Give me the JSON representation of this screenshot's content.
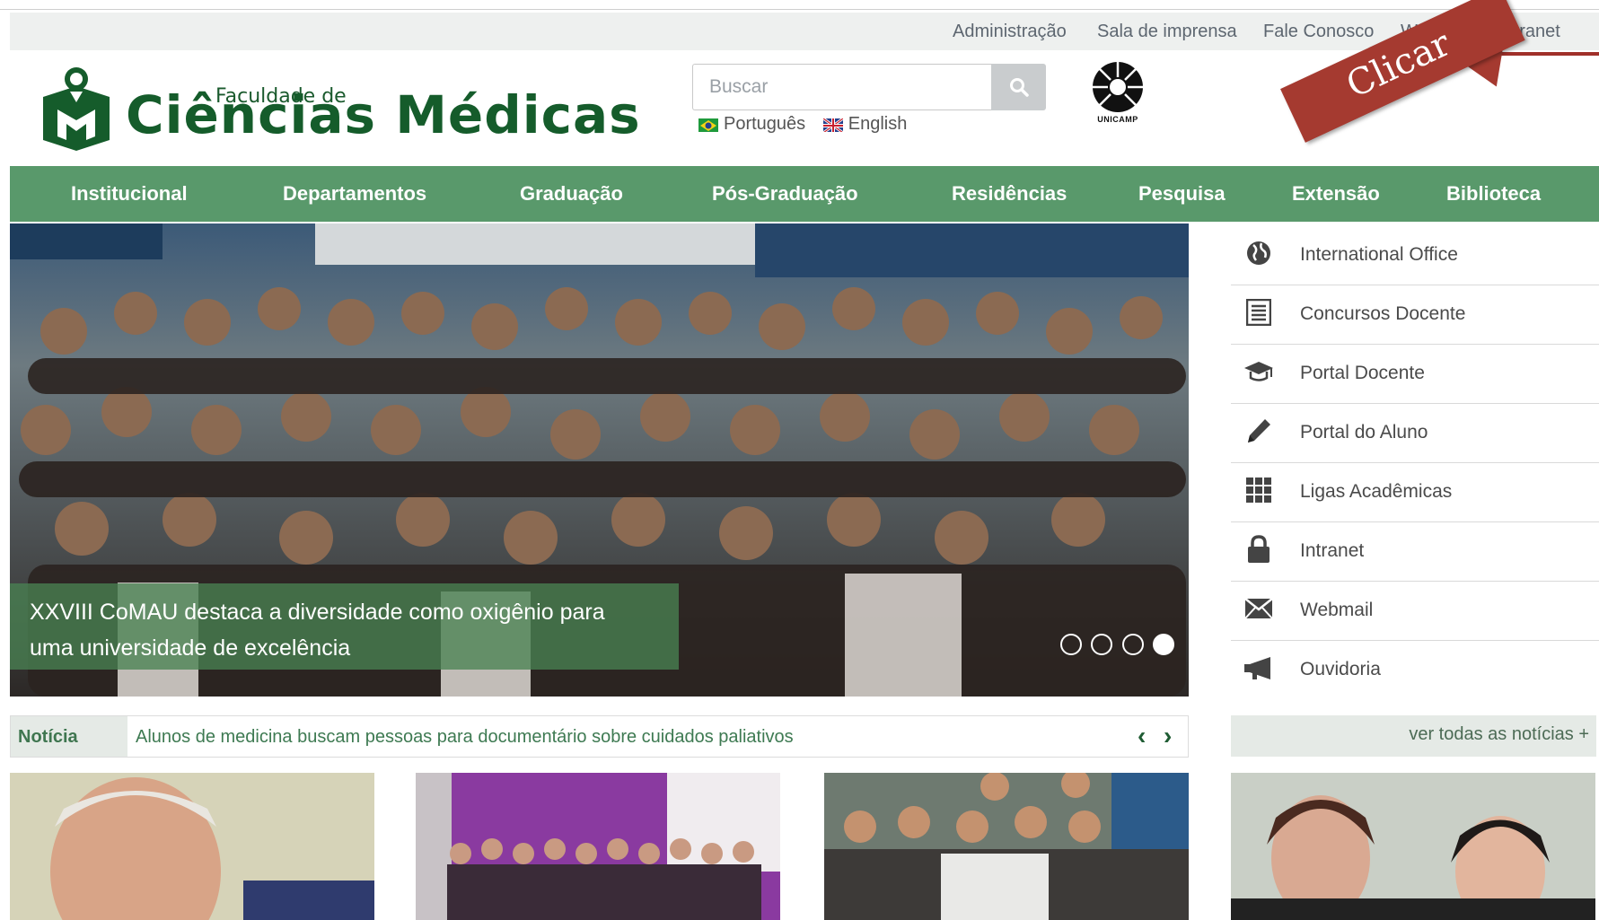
{
  "top_links": [
    "Administração",
    "Sala de imprensa",
    "Fale Conosco",
    "Webmail",
    "Intranet"
  ],
  "logo": {
    "line1": "Faculdade de",
    "line2": "Ciências Médicas"
  },
  "search": {
    "placeholder": "Buscar"
  },
  "languages": [
    {
      "label": "Português",
      "flag": "brazil"
    },
    {
      "label": "English",
      "flag": "uk"
    }
  ],
  "unicamp_label": "UNICAMP",
  "annotation": {
    "label": "Clicar",
    "color": "#a53a30"
  },
  "main_nav": [
    "Institucional",
    "Departamentos",
    "Graduação",
    "Pós-Graduação",
    "Residências",
    "Pesquisa",
    "Extensão",
    "Biblioteca"
  ],
  "hero": {
    "caption_line1": "XXVIII CoMAU destaca a diversidade como oxigênio para",
    "caption_line2": "uma universidade de excelência",
    "slides": 4,
    "active_slide": 4
  },
  "sidebar": [
    {
      "label": "International Office",
      "icon": "globe-icon"
    },
    {
      "label": "Concursos Docente",
      "icon": "list-icon"
    },
    {
      "label": "Portal Docente",
      "icon": "graduation-cap-icon"
    },
    {
      "label": "Portal do Aluno",
      "icon": "pencil-icon"
    },
    {
      "label": "Ligas Acadêmicas",
      "icon": "grid-icon"
    },
    {
      "label": "Intranet",
      "icon": "lock-icon"
    },
    {
      "label": "Webmail",
      "icon": "envelope-icon"
    },
    {
      "label": "Ouvidoria",
      "icon": "megaphone-icon"
    }
  ],
  "ticker": {
    "tag": "Notícia",
    "text": "Alunos de medicina buscam pessoas para documentário sobre cuidados paliativos",
    "prev": "‹",
    "next": "›"
  },
  "all_news": "ver todas as notícias +",
  "colors": {
    "nav_green": "#59996b",
    "brand_green": "#155c2b",
    "annotation_red": "#a53a30"
  }
}
